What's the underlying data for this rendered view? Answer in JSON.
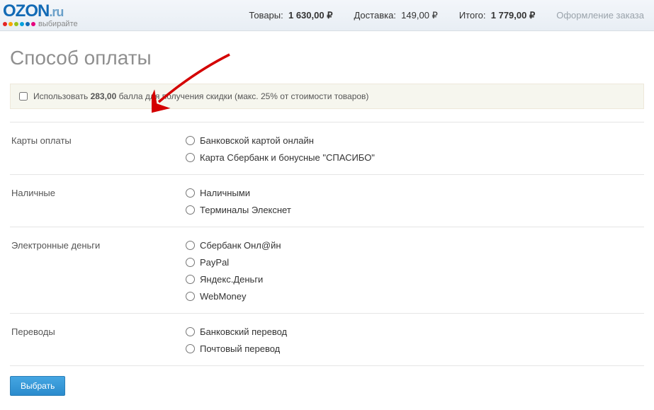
{
  "logo": {
    "main": "OZON",
    "suffix": ".ru",
    "tagline": "выбирайте",
    "dot_colors": [
      "#e32322",
      "#f7a600",
      "#9ac31c",
      "#00a0de",
      "#126ab5",
      "#e6007e"
    ]
  },
  "header": {
    "goods_label": "Товары:",
    "goods_value": "1 630,00 ₽",
    "delivery_label": "Доставка:",
    "delivery_value": "149,00 ₽",
    "total_label": "Итого:",
    "total_value": "1 779,00 ₽",
    "checkout_label": "Оформление заказа"
  },
  "page": {
    "title": "Способ оплаты"
  },
  "bonus": {
    "prefix": "Использовать",
    "amount": "283,00",
    "suffix": "балла для получения скидки (макс. 25% от стоимости товаров)"
  },
  "sections": [
    {
      "label": "Карты оплаты",
      "options": [
        "Банковской картой онлайн",
        "Карта Сбербанк и бонусные \"СПАСИБО\""
      ]
    },
    {
      "label": "Наличные",
      "options": [
        "Наличными",
        "Терминалы Элекснет"
      ]
    },
    {
      "label": "Электронные деньги",
      "options": [
        "Сбербанк Онл@йн",
        "PayPal",
        "Яндекс.Деньги",
        "WebMoney"
      ]
    },
    {
      "label": "Переводы",
      "options": [
        "Банковский перевод",
        "Почтовый перевод"
      ]
    }
  ],
  "actions": {
    "submit": "Выбрать"
  }
}
